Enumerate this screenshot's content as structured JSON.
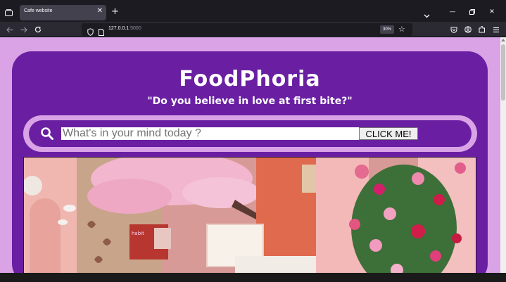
{
  "browser": {
    "tab_title": "Cafe website",
    "url_host": "127.0.0.1",
    "url_port": ":5000",
    "zoom": "30%"
  },
  "page": {
    "brand": "FoodPhoria",
    "tagline": "\"Do you believe in love at first bite?\"",
    "search": {
      "placeholder": "What's in your mind today ?",
      "button_label": "CLICK ME!"
    }
  },
  "icons": {
    "tab_overview": "tab-overview-icon",
    "back": "back-arrow-icon",
    "forward": "forward-arrow-icon",
    "reload": "reload-icon",
    "shield": "tracking-protection-icon",
    "page": "page-info-icon",
    "bookmark": "star-icon",
    "pocket": "pocket-icon",
    "account": "account-icon",
    "extensions": "extensions-icon",
    "menu": "hamburger-menu-icon",
    "search": "search-icon"
  },
  "colors": {
    "page_bg": "#d9a3e6",
    "card_bg": "#6a1fa3",
    "text": "#ffffff"
  }
}
